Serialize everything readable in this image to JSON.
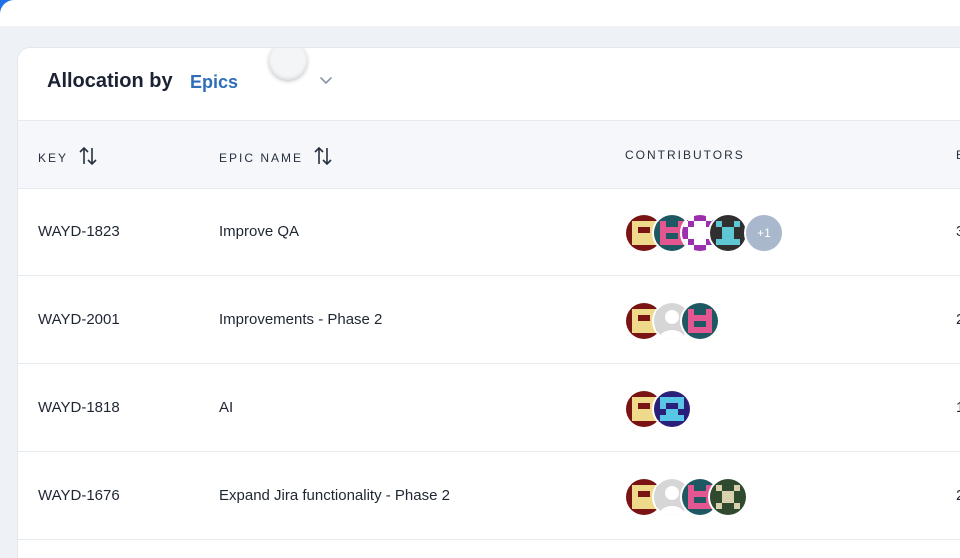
{
  "header": {
    "title": "Allocation by",
    "select_value": "Epics"
  },
  "columns": {
    "key": "KEY",
    "epic_name": "EPIC NAME",
    "contributors": "CONTRIBUTORS",
    "next": "E"
  },
  "rows": [
    {
      "key": "WAYD-1823",
      "name": "Improve QA",
      "more": "+1",
      "edge": "3"
    },
    {
      "key": "WAYD-2001",
      "name": "Improvements - Phase 2",
      "edge": "2"
    },
    {
      "key": "WAYD-1818",
      "name": "AI",
      "edge": "1"
    },
    {
      "key": "WAYD-1676",
      "name": "Expand Jira functionality - Phase 2",
      "edge": "2"
    }
  ],
  "colors": {
    "accent": "#2f6fb8",
    "brand_corner": "#1f6fe8"
  }
}
